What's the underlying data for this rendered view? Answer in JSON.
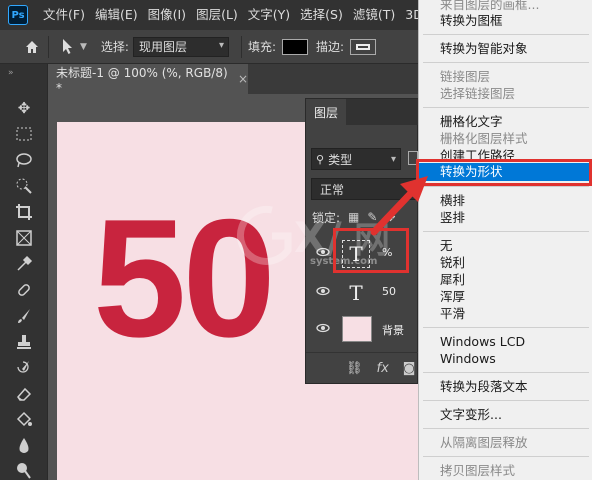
{
  "app": {
    "logo": "Ps"
  },
  "menu": [
    "文件(F)",
    "编辑(E)",
    "图像(I)",
    "图层(L)",
    "文字(Y)",
    "选择(S)",
    "滤镜(T)",
    "3D(D)"
  ],
  "options": {
    "select_label": "选择:",
    "select_value": "现用图层",
    "fill_label": "填充:",
    "stroke_label": "描边:"
  },
  "document": {
    "tab_title": "未标题-1 @ 100% (%, RGB/8) *",
    "canvas_text": "50",
    "canvas_color": "#c8243e",
    "canvas_bg": "#f7dfe4"
  },
  "layers_panel": {
    "title": "图层",
    "filter": "类型",
    "blend_mode": "正常",
    "lock_label": "锁定:",
    "layers": [
      {
        "name": "%",
        "kind": "text",
        "thumb": "T"
      },
      {
        "name": "50",
        "kind": "text",
        "thumb": "T"
      },
      {
        "name": "背景",
        "kind": "background"
      }
    ]
  },
  "context_menu": {
    "items": [
      {
        "label": "来自图层的画框...",
        "disabled": true
      },
      {
        "label": "转换为图框",
        "disabled": false
      },
      {
        "label": "转换为智能对象",
        "disabled": false
      },
      {
        "label": "链接图层",
        "disabled": true
      },
      {
        "label": "选择链接图层",
        "disabled": true
      },
      {
        "label": "栅格化文字",
        "disabled": false
      },
      {
        "label": "栅格化图层样式",
        "disabled": true
      },
      {
        "label": "创建工作路径",
        "disabled": false
      },
      {
        "label": "转换为形状",
        "disabled": false,
        "highlighted": true
      },
      {
        "label": "横排",
        "disabled": false
      },
      {
        "label": "竖排",
        "disabled": false
      },
      {
        "label": "无",
        "disabled": false
      },
      {
        "label": "锐利",
        "disabled": false
      },
      {
        "label": "犀利",
        "disabled": false
      },
      {
        "label": "浑厚",
        "disabled": false
      },
      {
        "label": "平滑",
        "disabled": false
      },
      {
        "label": "Windows LCD",
        "disabled": false
      },
      {
        "label": "Windows",
        "disabled": false
      },
      {
        "label": "转换为段落文本",
        "disabled": false
      },
      {
        "label": "文字变形...",
        "disabled": false
      },
      {
        "label": "从隔离图层释放",
        "disabled": true
      },
      {
        "label": "拷贝图层样式",
        "disabled": true
      }
    ]
  },
  "watermark": {
    "text": "G X/网",
    "sub": "system.com"
  },
  "colors": {
    "highlight": "#0078d7",
    "annotation": "#e0322f"
  }
}
